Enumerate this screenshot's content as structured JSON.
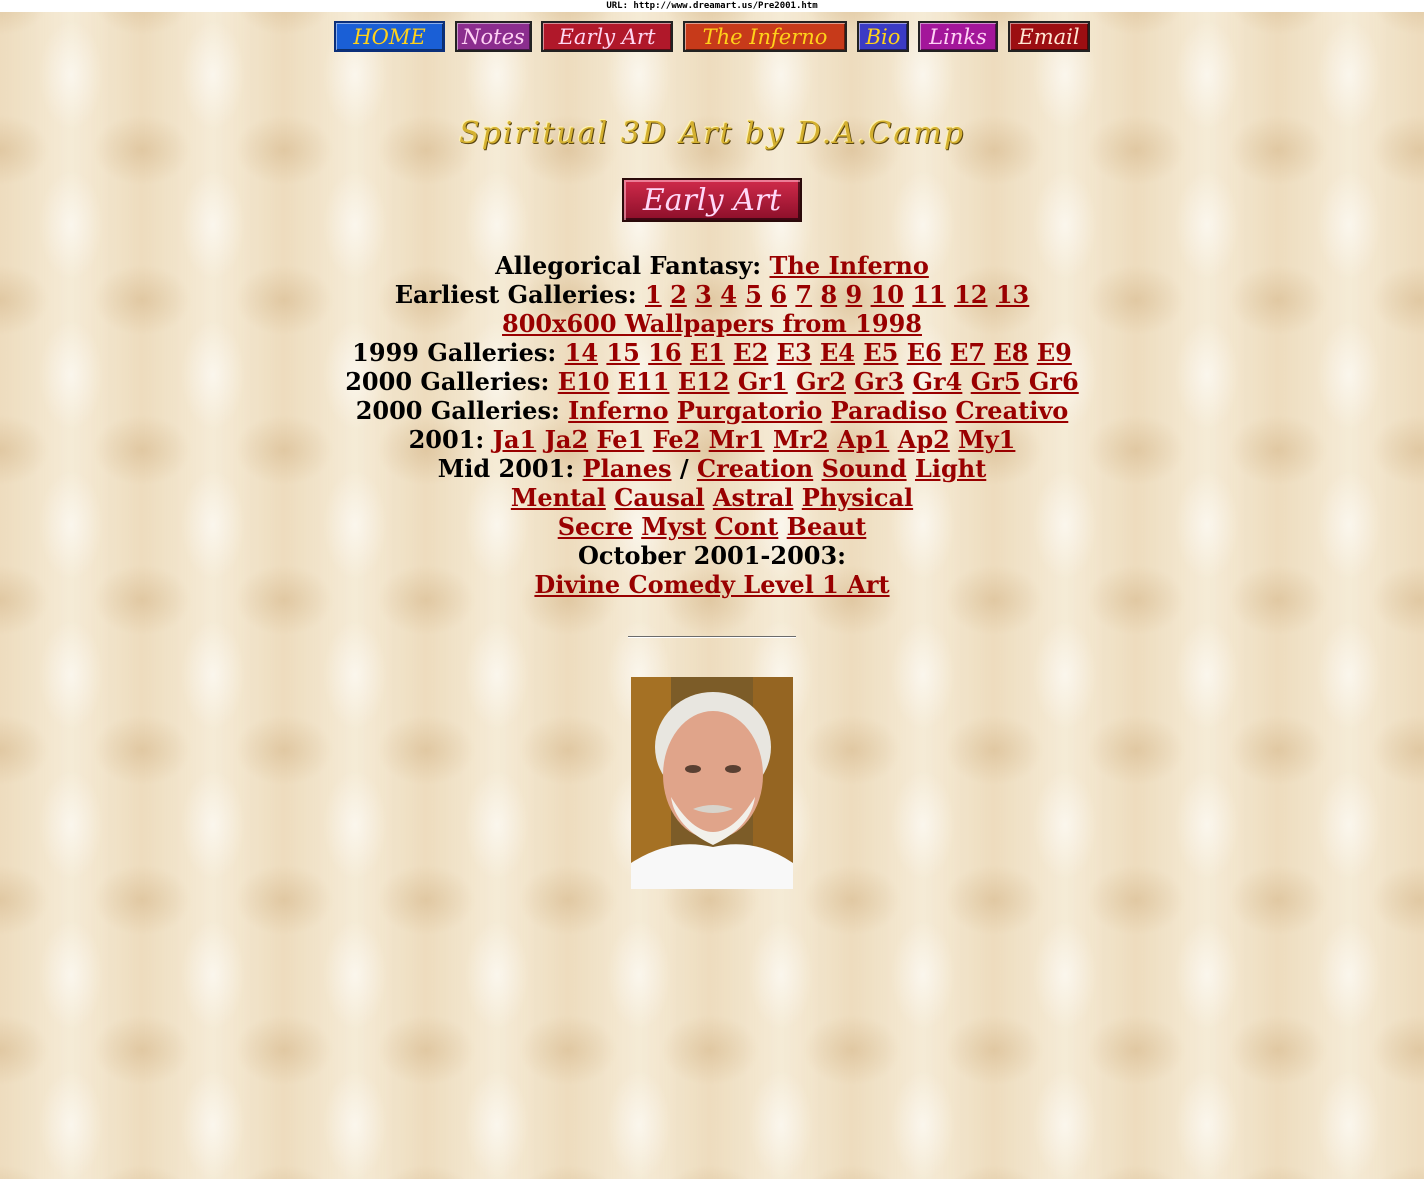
{
  "url_bar": {
    "text": "URL: http://www.dreamart.us/Pre2001.htm"
  },
  "nav": [
    {
      "label": "HOME",
      "name": "nav-home-button",
      "cls": "nb-home"
    },
    {
      "label": "Notes",
      "name": "nav-notes-button",
      "cls": "nb-notes"
    },
    {
      "label": "Early Art",
      "name": "nav-early-art-button",
      "cls": "nb-early"
    },
    {
      "label": "The Inferno",
      "name": "nav-the-inferno-button",
      "cls": "nb-inferno"
    },
    {
      "label": "Bio",
      "name": "nav-bio-button",
      "cls": "nb-bio"
    },
    {
      "label": "Links",
      "name": "nav-links-button",
      "cls": "nb-links"
    },
    {
      "label": "Email",
      "name": "nav-email-button",
      "cls": "nb-email"
    }
  ],
  "site_title": "Spiritual 3D Art by D.A.Camp",
  "section_badge": "Early Art",
  "gallery_lines": [
    {
      "parts": [
        {
          "t": "Allegorical Fantasy: "
        },
        {
          "a": "The Inferno"
        }
      ]
    },
    {
      "parts": [
        {
          "t": "Earliest Galleries: "
        },
        {
          "a": "1"
        },
        {
          "a": "2"
        },
        {
          "a": "3"
        },
        {
          "a": "4"
        },
        {
          "a": "5"
        },
        {
          "a": "6"
        },
        {
          "a": "7"
        },
        {
          "a": "8"
        },
        {
          "a": "9"
        },
        {
          "a": "10"
        },
        {
          "a": "11"
        },
        {
          "a": "12"
        },
        {
          "a": "13"
        }
      ]
    },
    {
      "parts": [
        {
          "a": "800x600 Wallpapers from 1998"
        }
      ]
    },
    {
      "parts": [
        {
          "t": "1999 Galleries: "
        },
        {
          "a": "14"
        },
        {
          "a": "15"
        },
        {
          "a": "16"
        },
        {
          "a": "E1"
        },
        {
          "a": "E2"
        },
        {
          "a": "E3"
        },
        {
          "a": "E4"
        },
        {
          "a": "E5"
        },
        {
          "a": "E6"
        },
        {
          "a": "E7"
        },
        {
          "a": "E8"
        },
        {
          "a": "E9"
        }
      ]
    },
    {
      "parts": [
        {
          "t": "2000 Galleries: "
        },
        {
          "a": "E10"
        },
        {
          "a": "E11"
        },
        {
          "a": "E12"
        },
        {
          "a": "Gr1"
        },
        {
          "a": "Gr2"
        },
        {
          "a": "Gr3"
        },
        {
          "a": "Gr4"
        },
        {
          "a": "Gr5"
        },
        {
          "a": "Gr6"
        }
      ]
    },
    {
      "parts": [
        {
          "t": "2000 Galleries: "
        },
        {
          "a": "Inferno"
        },
        {
          "a": "Purgatorio"
        },
        {
          "a": "Paradiso"
        },
        {
          "a": "Creativo"
        }
      ]
    },
    {
      "parts": [
        {
          "t": "2001: "
        },
        {
          "a": "Ja1"
        },
        {
          "a": "Ja2"
        },
        {
          "a": "Fe1"
        },
        {
          "a": "Fe2"
        },
        {
          "a": "Mr1"
        },
        {
          "a": "Mr2"
        },
        {
          "a": "Ap1"
        },
        {
          "a": "Ap2"
        },
        {
          "a": "My1"
        }
      ]
    },
    {
      "parts": [
        {
          "t": "Mid 2001: "
        },
        {
          "a": "Planes"
        },
        {
          "t": " / "
        },
        {
          "a": "Creation"
        },
        {
          "a": "Sound"
        },
        {
          "a": "Light"
        }
      ]
    },
    {
      "parts": [
        {
          "a": "Mental"
        },
        {
          "a": "Causal"
        },
        {
          "a": "Astral"
        },
        {
          "a": "Physical"
        }
      ]
    },
    {
      "parts": [
        {
          "a": "Secre"
        },
        {
          "a": "Myst"
        },
        {
          "a": "Cont"
        },
        {
          "a": "Beaut"
        }
      ]
    },
    {
      "parts": [
        {
          "t": "October 2001-2003:"
        }
      ]
    },
    {
      "parts": [
        {
          "a": "Divine Comedy Level 1 Art"
        }
      ]
    }
  ],
  "colors": {
    "link": "#990000",
    "title_gold": "#d4b030"
  },
  "photo": {
    "icon": "artist-portrait"
  }
}
